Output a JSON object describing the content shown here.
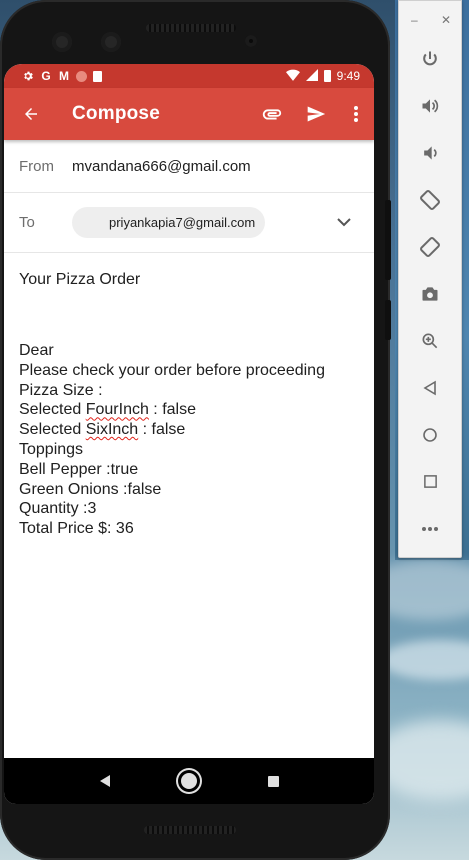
{
  "status_bar": {
    "icons": [
      "settings-icon",
      "google-icon",
      "gmail-icon",
      "record-icon",
      "sd-card-icon"
    ],
    "right_icons": [
      "wifi-icon",
      "signal-icon",
      "battery-icon"
    ],
    "time": "9:49",
    "glyph_g": "G",
    "glyph_m": "M"
  },
  "app_bar": {
    "title": "Compose",
    "actions": [
      "attach-icon",
      "send-icon",
      "more-vert-icon"
    ]
  },
  "compose": {
    "from_label": "From",
    "from_value": "mvandana666@gmail.com",
    "to_label": "To",
    "to_chip": "priyankapia7@gmail.com",
    "subject": "Your Pizza Order",
    "body_lines": [
      {
        "text": "Dear"
      },
      {
        "text": "Please check your order before proceeding"
      },
      {
        "text": "Pizza Size :"
      },
      {
        "pre": "Selected ",
        "spell": "FourInch",
        "post": " : false"
      },
      {
        "pre": "Selected ",
        "spell": "SixInch",
        "post": " : false"
      },
      {
        "text": "Toppings"
      },
      {
        "text": "Bell Pepper :true"
      },
      {
        "text": "Green Onions :false"
      },
      {
        "text": "Quantity :3"
      },
      {
        "text": "Total Price $: 36"
      }
    ]
  },
  "navigation": [
    "back-nav-icon",
    "home-nav-icon",
    "recents-nav-icon"
  ],
  "emulator_toolbar": {
    "window_controls": [
      "–",
      "✕"
    ],
    "items": [
      "power-icon",
      "volume-up-icon",
      "volume-down-icon",
      "rotate-left-icon",
      "rotate-right-icon",
      "camera-icon",
      "zoom-icon",
      "back-icon",
      "home-icon",
      "overview-icon",
      "more-icon"
    ]
  },
  "colors": {
    "status_bar": "#c5382e",
    "app_bar": "#d84a3e",
    "spellcheck": "#e0241b"
  }
}
